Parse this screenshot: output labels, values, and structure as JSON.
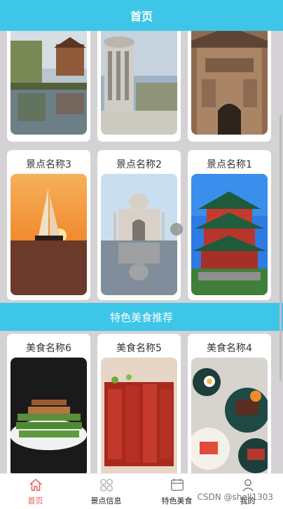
{
  "header": {
    "title": "首页"
  },
  "scenic": {
    "top_cards": [
      {
        "image": "lake-pagoda-photo"
      },
      {
        "image": "rotunda-monument-photo"
      },
      {
        "image": "ornate-gate-photo"
      }
    ],
    "cards": [
      {
        "label": "景点名称3",
        "image": "sailboat-sunset-photo"
      },
      {
        "label": "景点名称2",
        "image": "taj-mahal-reflection-photo"
      },
      {
        "label": "景点名称1",
        "image": "chinese-pavilion-photo"
      }
    ]
  },
  "food_section": {
    "title": "特色美食推荐"
  },
  "food": {
    "cards": [
      {
        "label": "美食名称6",
        "image": "green-pepper-meat-photo"
      },
      {
        "label": "美食名称5",
        "image": "red-braised-meat-photo"
      },
      {
        "label": "美食名称4",
        "image": "plated-dishes-photo"
      }
    ]
  },
  "tabbar": {
    "items": [
      {
        "label": "首页",
        "icon": "home-icon",
        "active": true
      },
      {
        "label": "景点信息",
        "icon": "grid-icon",
        "active": false
      },
      {
        "label": "特色美食",
        "icon": "calendar-icon",
        "active": false
      },
      {
        "label": "我的",
        "icon": "user-icon",
        "active": false
      }
    ],
    "active_color": "#e85a4f"
  },
  "watermark": "CSDN @shell1303",
  "colors": {
    "accent": "#3ec6e8",
    "background": "#d4d2d4"
  }
}
